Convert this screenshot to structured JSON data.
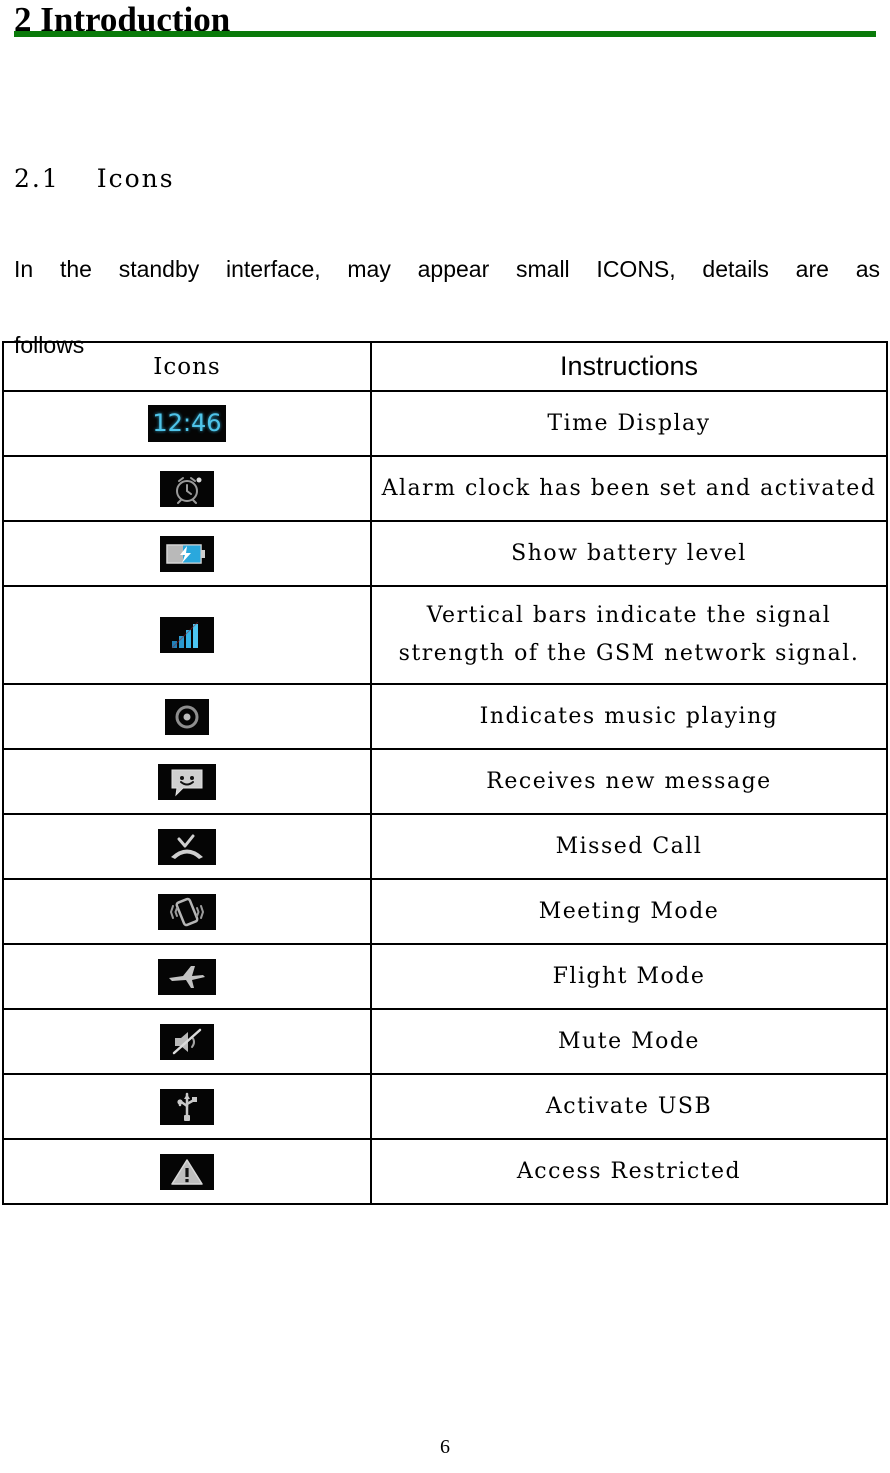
{
  "document": {
    "chapter_title": "2 Introduction",
    "accent_color": "#0a7a0a",
    "section_title": "2.1　 Icons",
    "intro_paragraph_line1": "In the standby interface, may appear small ICONS, details are as",
    "intro_paragraph_line2": "follows",
    "page_number": "6"
  },
  "table": {
    "headers": {
      "icons": "Icons",
      "instructions": "Instructions"
    },
    "rows": [
      {
        "icon_name": "time-display-icon",
        "icon_type": "clock",
        "icon_label": "12:46",
        "instruction": "Time Display",
        "lines": 1
      },
      {
        "icon_name": "alarm-clock-icon",
        "icon_type": "alarm",
        "icon_label": "",
        "instruction": "Alarm clock has been set and activated",
        "lines": 1
      },
      {
        "icon_name": "battery-charging-icon",
        "icon_type": "battery",
        "icon_label": "",
        "instruction": "Show battery level",
        "lines": 1
      },
      {
        "icon_name": "signal-strength-icon",
        "icon_type": "signal",
        "icon_label": "",
        "instruction": "Vertical bars indicate the signal",
        "instruction_line2": "strength of the GSM network signal.",
        "lines": 2
      },
      {
        "icon_name": "music-playing-icon",
        "icon_type": "music",
        "icon_label": "",
        "instruction": "Indicates music playing",
        "lines": 1
      },
      {
        "icon_name": "new-message-icon",
        "icon_type": "message",
        "icon_label": "",
        "instruction": "Receives new message",
        "lines": 1
      },
      {
        "icon_name": "missed-call-icon",
        "icon_type": "missedcall",
        "icon_label": "",
        "instruction": "Missed Call",
        "lines": 1
      },
      {
        "icon_name": "meeting-mode-icon",
        "icon_type": "vibrate",
        "icon_label": "",
        "instruction": "Meeting Mode",
        "lines": 1
      },
      {
        "icon_name": "flight-mode-icon",
        "icon_type": "airplane",
        "icon_label": "",
        "instruction": "Flight Mode",
        "lines": 1
      },
      {
        "icon_name": "mute-mode-icon",
        "icon_type": "mute",
        "icon_label": "",
        "instruction": "Mute Mode",
        "lines": 1
      },
      {
        "icon_name": "usb-icon",
        "icon_type": "usb",
        "icon_label": "",
        "instruction": "Activate USB",
        "lines": 1
      },
      {
        "icon_name": "access-restricted-icon",
        "icon_type": "warning",
        "icon_label": "",
        "instruction": "Access Restricted",
        "lines": 1
      }
    ]
  }
}
